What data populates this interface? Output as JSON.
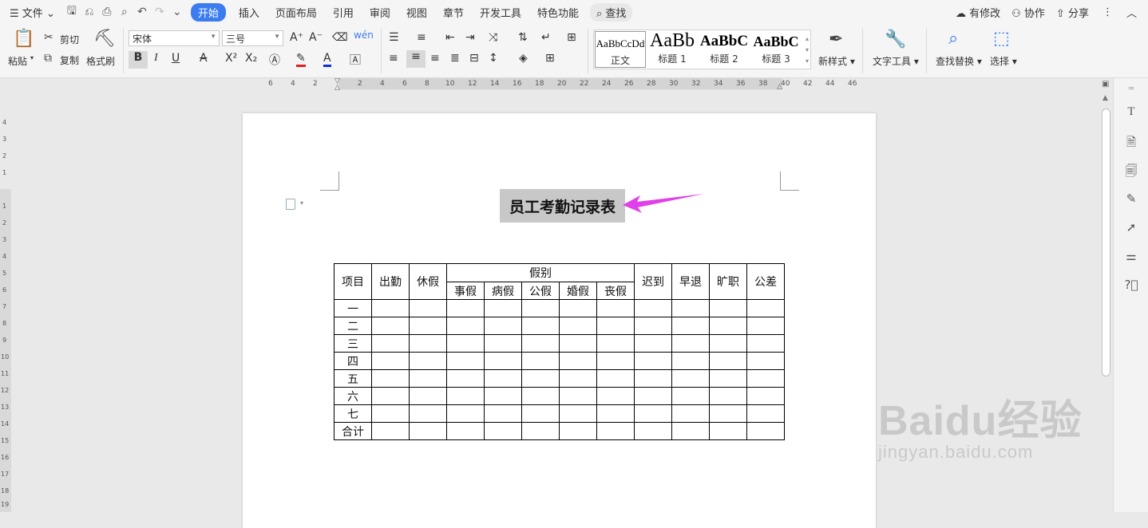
{
  "menubar": {
    "file": "文件",
    "tabs": [
      "开始",
      "插入",
      "页面布局",
      "引用",
      "审阅",
      "视图",
      "章节",
      "开发工具",
      "特色功能"
    ],
    "active_tab": "开始",
    "search": "查找",
    "right": [
      "有修改",
      "协作",
      "分享"
    ]
  },
  "ribbon": {
    "paste": "粘贴",
    "cut": "剪切",
    "copy": "复制",
    "format_painter": "格式刷",
    "font_name": "宋体",
    "font_size": "三号",
    "styles": [
      {
        "sample": "AaBbCcDd",
        "name": "正文"
      },
      {
        "sample": "AaBb",
        "name": "标题 1"
      },
      {
        "sample": "AaBbC",
        "name": "标题 2"
      },
      {
        "sample": "AaBbC",
        "name": "标题 3"
      }
    ],
    "new_style": "新样式",
    "text_tools": "文字工具",
    "find_replace": "查找替换",
    "select": "选择"
  },
  "ruler": {
    "h": [
      "6",
      "4",
      "2",
      "2",
      "4",
      "6",
      "8",
      "10",
      "12",
      "14",
      "16",
      "18",
      "20",
      "22",
      "24",
      "26",
      "28",
      "30",
      "32",
      "34",
      "36",
      "38",
      "40",
      "42",
      "44",
      "46"
    ],
    "v": [
      "4",
      "3",
      "2",
      "1",
      "1",
      "2",
      "3",
      "4",
      "5",
      "6",
      "7",
      "8",
      "9",
      "10",
      "11",
      "12",
      "13",
      "14",
      "15",
      "16",
      "17",
      "18",
      "19"
    ]
  },
  "document": {
    "title": "员工考勤记录表",
    "table": {
      "header_top": [
        "项目",
        "出勤",
        "休假",
        "假别",
        "迟到",
        "早退",
        "旷职",
        "公差"
      ],
      "leave_types": [
        "事假",
        "病假",
        "公假",
        "婚假",
        "丧假"
      ],
      "rows": [
        "一",
        "二",
        "三",
        "四",
        "五",
        "六",
        "七",
        "合计"
      ]
    }
  },
  "watermark": {
    "brand": "Baidu经验",
    "url": "jingyan.baidu.com"
  },
  "colors": {
    "accent": "#3b7cf0",
    "arrow": "#e040e8"
  }
}
